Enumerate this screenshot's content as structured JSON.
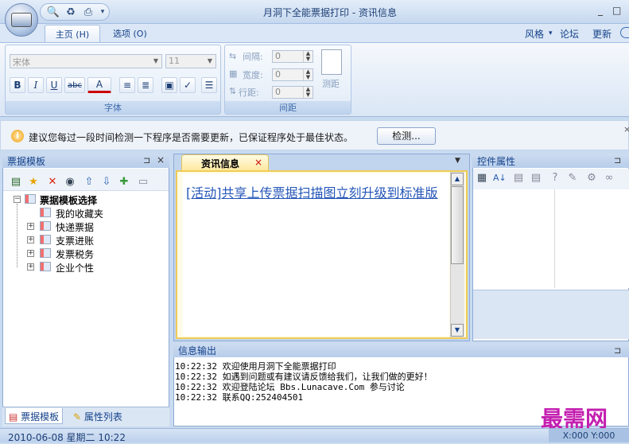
{
  "window": {
    "title": "月洞下全能票据打印 - 资讯信息",
    "controls": {
      "minimize": "_",
      "maximize": "□"
    }
  },
  "ribbon_tabs": [
    {
      "label": "主页 (H)",
      "active": true
    },
    {
      "label": "选项 (O)",
      "active": false
    }
  ],
  "ribbon_right": {
    "style": "风格",
    "forum": "论坛",
    "update": "更新"
  },
  "font_group": {
    "label": "字体",
    "font_name": "宋体",
    "font_size": "11",
    "buttons": [
      "B",
      "I",
      "U",
      "abc",
      "A"
    ]
  },
  "spacing_group": {
    "label": "间距",
    "interval_label": "间隔:",
    "interval_value": "0",
    "width_label": "宽度:",
    "width_value": "0",
    "line_label": "行距:",
    "line_value": "0",
    "measure_label": "测距"
  },
  "info_bar": {
    "text": "建议您每过一段时间检测一下程序是否需要更新，已保证程序处于最佳状态。",
    "button": "检测..."
  },
  "left_panel": {
    "title": "票据模板",
    "tree": {
      "root": "票据模板选择",
      "children": [
        "我的收藏夹",
        "快递票据",
        "支票进账",
        "发票税务",
        "企业个性"
      ]
    },
    "bottom_tabs": [
      "票据模板",
      "属性列表"
    ]
  },
  "document": {
    "tab_label": "资讯信息",
    "link": "[活动]共享上传票据扫描图立刻升级到标准版"
  },
  "right_panel": {
    "title": "控件属性"
  },
  "output": {
    "title": "信息输出",
    "lines": [
      "10:22:32 欢迎使用月洞下全能票据打印",
      "10:22:32 如遇到问题或有建议请反馈给我们，让我们做的更好！",
      "10:22:32 欢迎登陆论坛 Bbs.Lunacave.Com 参与讨论",
      "10:22:32 联系QQ:252404501"
    ]
  },
  "status": {
    "datetime": "2010-06-08 星期二 10:22",
    "coords": "X:000 Y:000"
  },
  "watermark": "最需网",
  "colors": {
    "accent": "#15428b",
    "ribbon_bg": "#dae6f5",
    "link": "#2456b8",
    "watermark": "#c41fb0"
  }
}
